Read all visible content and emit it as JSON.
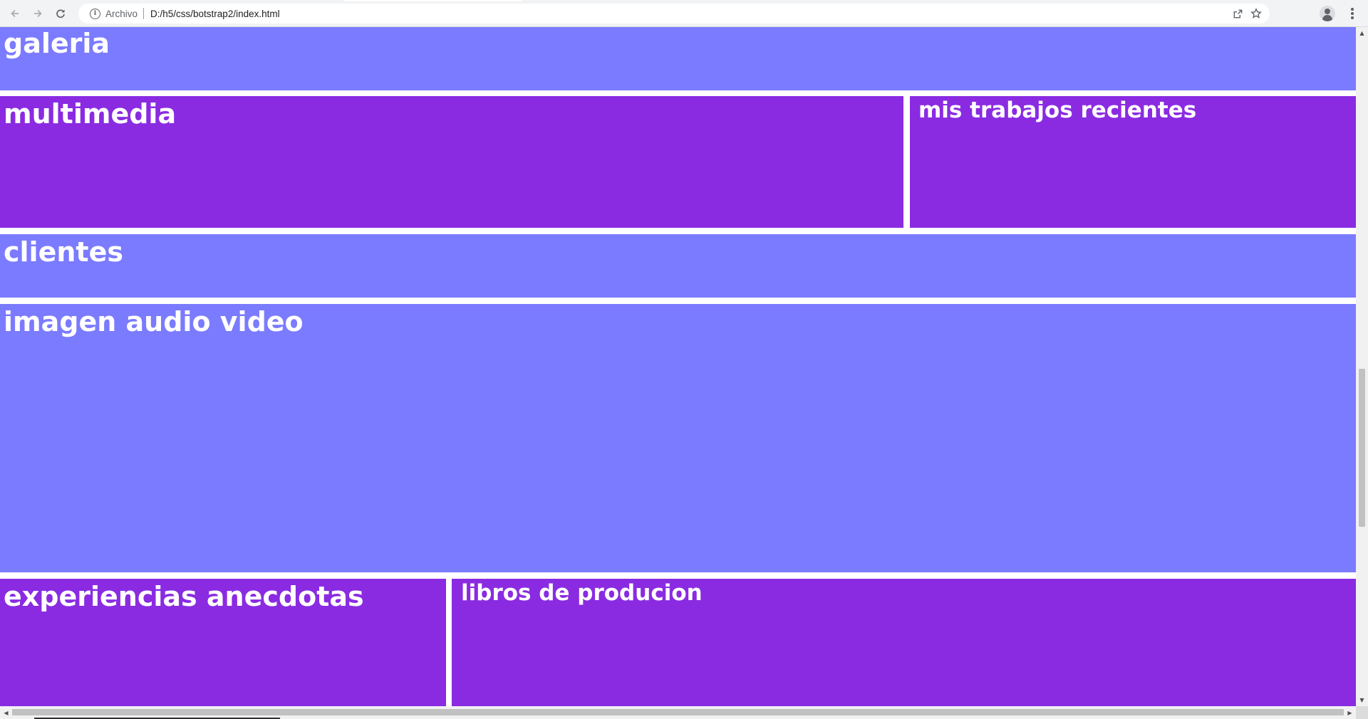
{
  "browser": {
    "security_label": "Archivo",
    "url": "D:/h5/css/botstrap2/index.html",
    "icons": {
      "back": "arrow-left-icon",
      "forward": "arrow-right-icon",
      "reload": "reload-icon",
      "info": "info-icon",
      "share": "share-icon",
      "bookmark": "star-icon",
      "profile": "avatar-icon",
      "menu": "vertical-dots-icon"
    }
  },
  "page": {
    "colors": {
      "lavender": "#7b7bff",
      "purple": "#8a2be2",
      "text": "#ffffff"
    },
    "sections": {
      "galeria": "galeria",
      "multimedia": "multimedia",
      "trabajos": "mis trabajos recientes",
      "clientes": "clientes",
      "imagen_audio_video": "imagen audio video",
      "experiencias": "experiencias anecdotas",
      "libros": "libros de producion"
    }
  }
}
